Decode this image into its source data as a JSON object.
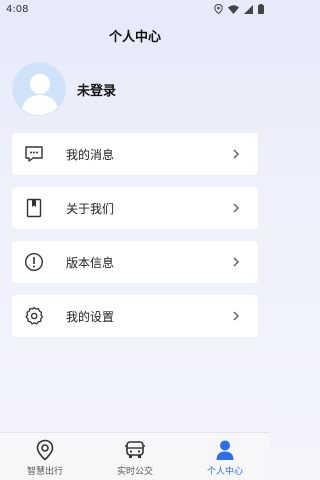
{
  "status_bar": {
    "time": "4:08",
    "icons": [
      "location-icon",
      "wifi-icon",
      "signal-icon",
      "battery-icon"
    ]
  },
  "header": {
    "title": "个人中心"
  },
  "profile": {
    "username": "未登录",
    "avatar_icon": "default-avatar-icon"
  },
  "menu": {
    "items": [
      {
        "label": "我的消息",
        "icon": "message-icon"
      },
      {
        "label": "关于我们",
        "icon": "bookmark-book-icon"
      },
      {
        "label": "版本信息",
        "icon": "info-exclamation-icon"
      },
      {
        "label": "我的设置",
        "icon": "gear-icon"
      }
    ],
    "arrow_icon": "chevron-right-icon"
  },
  "tabbar": {
    "tabs": [
      {
        "label": "智慧出行",
        "icon": "location-pin-icon",
        "active": false
      },
      {
        "label": "实时公交",
        "icon": "bus-icon",
        "active": false
      },
      {
        "label": "个人中心",
        "icon": "person-icon",
        "active": true
      }
    ]
  },
  "colors": {
    "accent": "#2d6fe8",
    "background_top": "#e6eaf9",
    "card": "#ffffff",
    "avatar_bg": "#cfe2f7"
  }
}
